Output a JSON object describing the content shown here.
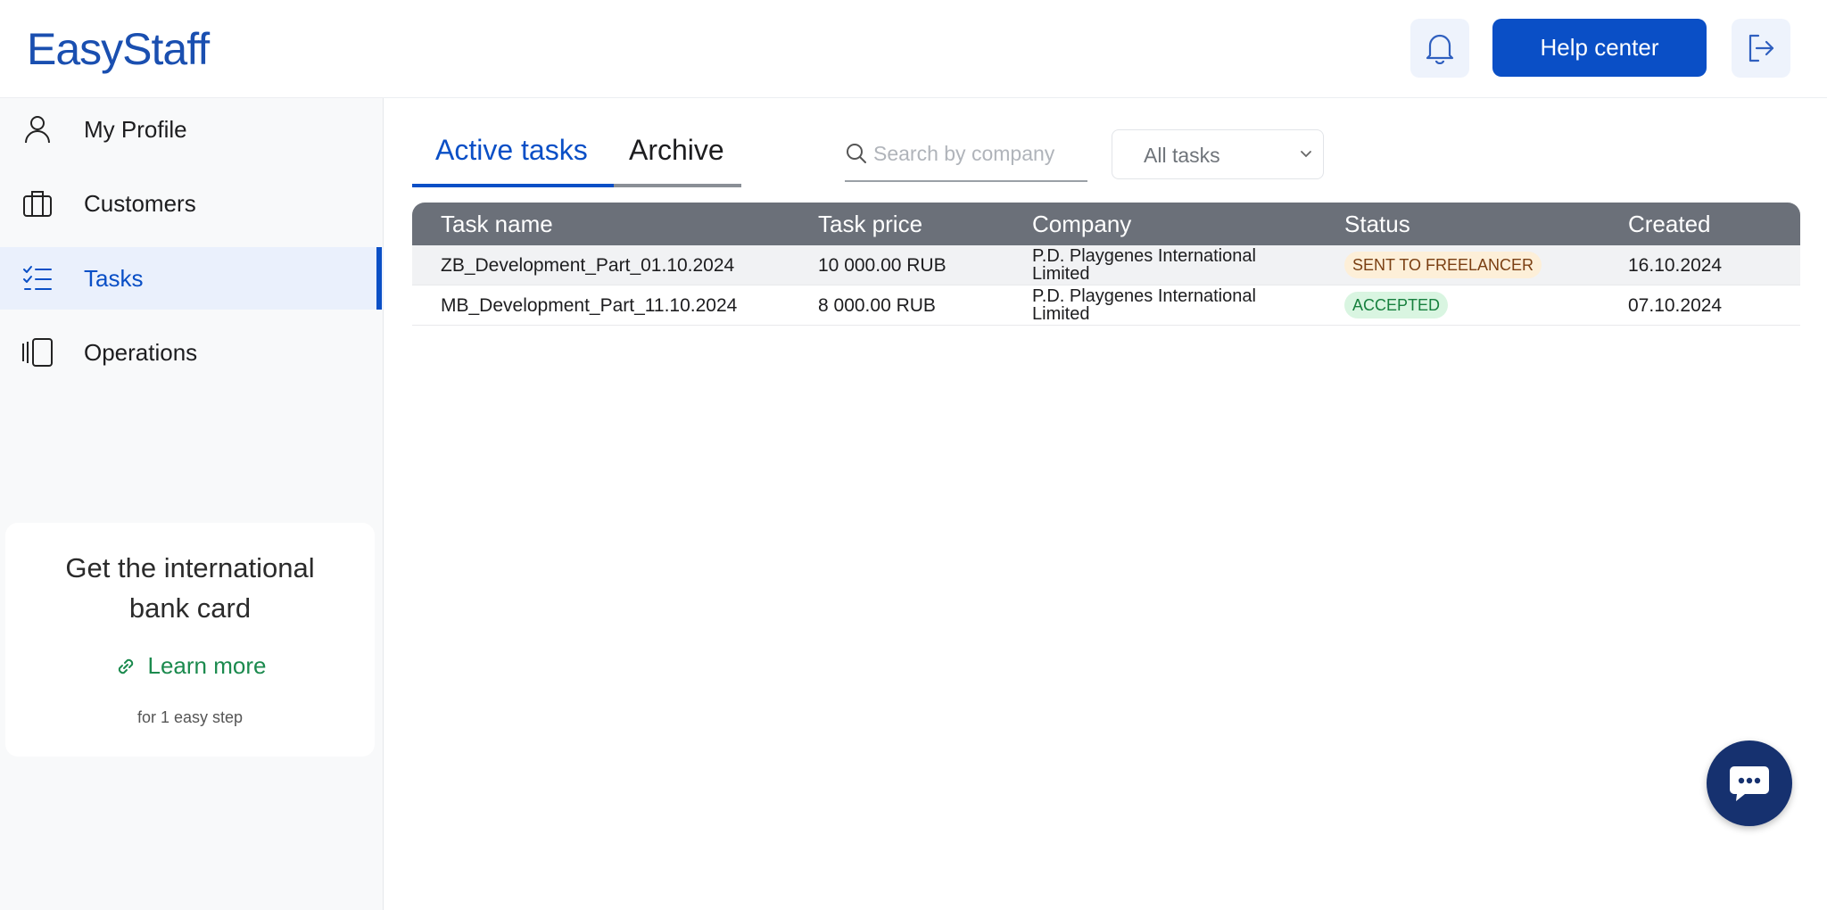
{
  "header": {
    "logo": "EasyStaff",
    "help_label": "Help center"
  },
  "sidebar": {
    "items": [
      {
        "label": "My Profile",
        "icon": "user-icon"
      },
      {
        "label": "Customers",
        "icon": "briefcase-icon"
      },
      {
        "label": "Tasks",
        "icon": "checklist-icon",
        "active": true
      },
      {
        "label": "Operations",
        "icon": "operations-icon"
      }
    ],
    "promo": {
      "title_line1": "Get the international",
      "title_line2": "bank card",
      "link": "Learn more",
      "sub": "for 1 easy step"
    }
  },
  "tabs": {
    "active": "Active tasks",
    "archive": "Archive"
  },
  "search": {
    "placeholder": "Search by company",
    "value": ""
  },
  "filter": {
    "selected": "All tasks"
  },
  "table": {
    "headers": [
      "Task name",
      "Task price",
      "Company",
      "Status",
      "Created"
    ],
    "rows": [
      {
        "name": "ZB_Development_Part_01.10.2024",
        "price": "10 000.00 RUB",
        "company_line1": "P.D. Playgenes International",
        "company_line2": "Limited",
        "status": "SENT TO FREELANCER",
        "created": "16.10.2024"
      },
      {
        "name": "MB_Development_Part_11.10.2024",
        "price": "8 000.00 RUB",
        "company_line1": "P.D. Playgenes International",
        "company_line2": "Limited",
        "status": "ACCEPTED",
        "created": "07.10.2024"
      }
    ]
  },
  "colors": {
    "primary": "#0a4fc6",
    "header_row": "#6b7079",
    "success": "#1b8a4e",
    "chat": "#16316f"
  }
}
